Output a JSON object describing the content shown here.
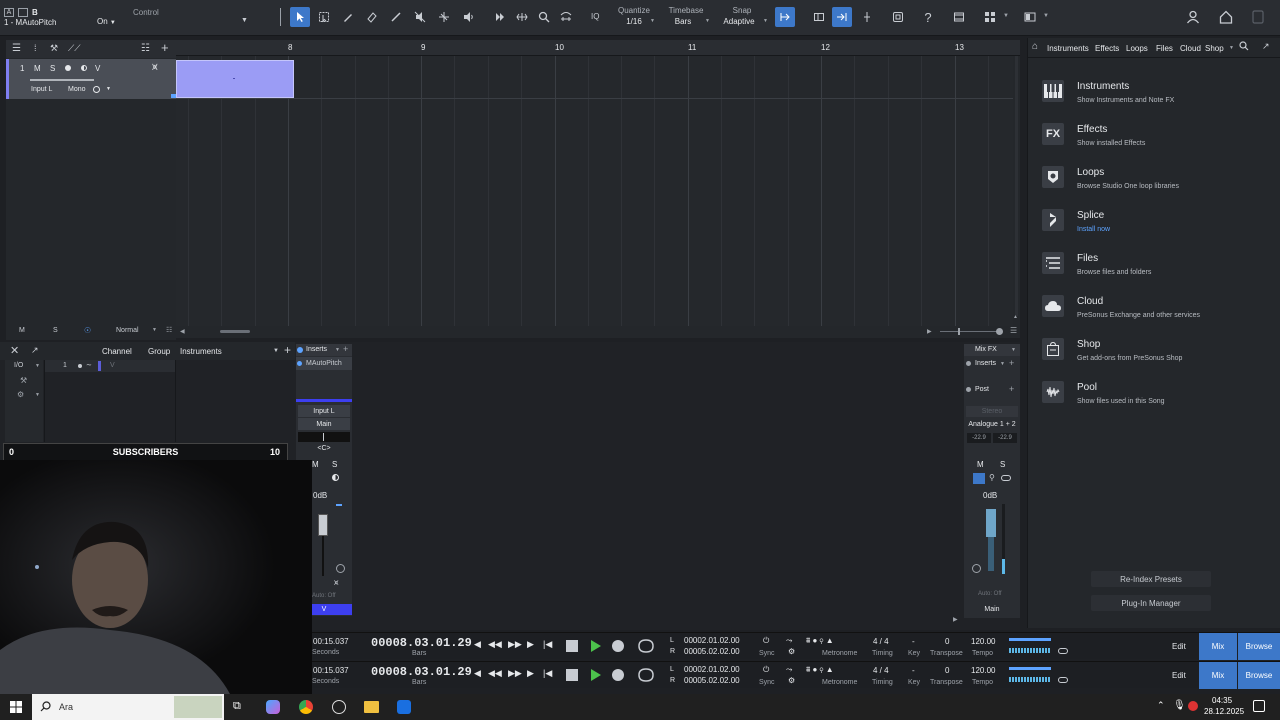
{
  "toolbar": {
    "track_number": "B",
    "track_name": "1 - MAutoPitch",
    "on_label": "On",
    "control_label": "Control",
    "quantize_label": "Quantize",
    "quantize_value": "1/16",
    "timebase_label": "Timebase",
    "timebase_value": "Bars",
    "snap_label": "Snap",
    "snap_value": "Adaptive",
    "iq_label": "IQ"
  },
  "ruler": {
    "bars": [
      "8",
      "9",
      "10",
      "11",
      "12",
      "13"
    ]
  },
  "track": {
    "number": "1",
    "m": "M",
    "s": "S",
    "v": "V",
    "input": "Input L",
    "mode": "Mono"
  },
  "arrange_footer": {
    "m": "M",
    "s": "S",
    "mode": "Normal"
  },
  "browser": {
    "tabs": [
      "Instruments",
      "Effects",
      "Loops",
      "Files",
      "Cloud",
      "Shop"
    ],
    "items": [
      {
        "title": "Instruments",
        "sub": "Show Instruments and Note FX",
        "icon": "piano-icon"
      },
      {
        "title": "Effects",
        "sub": "Show installed Effects",
        "icon": "fx-icon",
        "glyph": "FX"
      },
      {
        "title": "Loops",
        "sub": "Browse Studio One loop libraries",
        "icon": "loops-icon"
      },
      {
        "title": "Splice",
        "sub": "Install now",
        "icon": "splice-icon"
      },
      {
        "title": "Files",
        "sub": "Browse files and folders",
        "icon": "files-icon"
      },
      {
        "title": "Cloud",
        "sub": "PreSonus Exchange and other services",
        "icon": "cloud-icon"
      },
      {
        "title": "Shop",
        "sub": "Get add-ons from PreSonus Shop",
        "icon": "shop-icon"
      },
      {
        "title": "Pool",
        "sub": "Show files used in this Song",
        "icon": "pool-icon"
      }
    ],
    "reindex": "Re-Index Presets",
    "plugin_manager": "Plug-In Manager"
  },
  "console": {
    "io": "I/O",
    "channel": "Channel",
    "group": "Group",
    "instruments": "Instruments",
    "row_number": "1",
    "row_v": "V",
    "inserts": "Inserts",
    "insert_plugin": "MAutoPitch",
    "input": "Input L",
    "main": "Main",
    "pan": "<C>",
    "m": "M",
    "s": "S",
    "db": "0dB",
    "auto": "Auto: Off",
    "v": "V",
    "mixfx": "Mix FX",
    "inserts_right": "Inserts",
    "post": "Post",
    "stereo": "Stereo",
    "analogue": "Analogue 1 + 2",
    "level_l": "-22.9",
    "level_r": "-22.9",
    "m_right": "M",
    "s_right": "S",
    "db_right": "0dB",
    "auto_right": "Auto: Off",
    "main_right": "Main"
  },
  "subs": {
    "left": "0",
    "label": "SUBSCRIBERS",
    "right": "10"
  },
  "transport": [
    {
      "time": "00:15.037",
      "seconds": "Seconds",
      "position": "00008.03.01.29",
      "bars": "Bars",
      "l": "L",
      "r": "R",
      "loop_l": "00002.01.02.00",
      "loop_r": "00005.02.02.00",
      "sync": "Sync",
      "metronome": "Metronome",
      "timing_value": "4 / 4",
      "timing": "Timing",
      "key_value": "-",
      "key": "Key",
      "transpose_value": "0",
      "transpose": "Transpose",
      "tempo_value": "120.00",
      "tempo": "Tempo",
      "edit": "Edit",
      "mix": "Mix",
      "browse": "Browse"
    },
    {
      "time": "00:15.037",
      "seconds": "Seconds",
      "position": "00008.03.01.29",
      "bars": "Bars",
      "l": "L",
      "r": "R",
      "loop_l": "00002.01.02.00",
      "loop_r": "00005.02.02.00",
      "sync": "Sync",
      "metronome": "Metronome",
      "timing_value": "4 / 4",
      "timing": "Timing",
      "key_value": "-",
      "key": "Key",
      "transpose_value": "0",
      "transpose": "Transpose",
      "tempo_value": "120.00",
      "tempo": "Tempo",
      "edit": "Edit",
      "mix": "Mix",
      "browse": "Browse"
    }
  ],
  "taskbar": {
    "search_placeholder": "Ara",
    "time": "04:35",
    "date": "28.12.2025"
  },
  "colors": {
    "accent": "#3d78c9",
    "clip": "#9b9cf5",
    "bg": "#1e2024"
  }
}
